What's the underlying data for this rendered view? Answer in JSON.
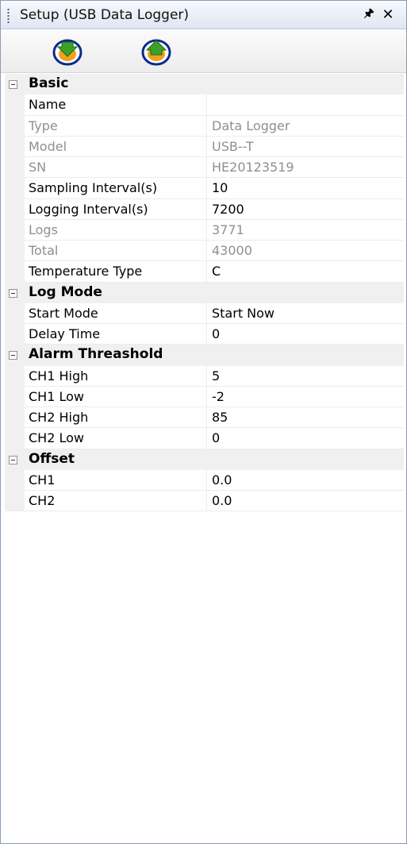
{
  "window": {
    "title": "Setup (USB Data Logger)",
    "pin_icon": "pin-icon",
    "close_icon": "close-icon"
  },
  "toolbar": {
    "download_icon": "download-arrow-icon",
    "upload_icon": "upload-arrow-icon",
    "colors": {
      "ring": "#0a2a8a",
      "fill": "#f0a020",
      "arrow": "#3ca12a"
    }
  },
  "categories": [
    {
      "label": "Basic",
      "props": [
        {
          "name": "Name",
          "value": "",
          "readonly": false
        },
        {
          "name": "Type",
          "value": "Data Logger",
          "readonly": true
        },
        {
          "name": "Model",
          "value": "USB--T",
          "readonly": true
        },
        {
          "name": "SN",
          "value": "HE20123519",
          "readonly": true
        },
        {
          "name": "Sampling Interval(s)",
          "value": "10",
          "readonly": false
        },
        {
          "name": "Logging Interval(s)",
          "value": "7200",
          "readonly": false
        },
        {
          "name": "Logs",
          "value": "3771",
          "readonly": true
        },
        {
          "name": "Total",
          "value": "43000",
          "readonly": true
        },
        {
          "name": "Temperature Type",
          "value": "C",
          "readonly": false
        }
      ]
    },
    {
      "label": "Log Mode",
      "props": [
        {
          "name": "Start Mode",
          "value": "Start Now",
          "readonly": false
        },
        {
          "name": "Delay Time",
          "value": "0",
          "readonly": false
        }
      ]
    },
    {
      "label": "Alarm Threashold",
      "props": [
        {
          "name": "CH1 High",
          "value": "5",
          "readonly": false
        },
        {
          "name": "CH1 Low",
          "value": "-2",
          "readonly": false
        },
        {
          "name": "CH2 High",
          "value": "85",
          "readonly": false
        },
        {
          "name": "CH2 Low",
          "value": "0",
          "readonly": false
        }
      ]
    },
    {
      "label": "Offset",
      "props": [
        {
          "name": "CH1",
          "value": "0.0",
          "readonly": false
        },
        {
          "name": "CH2",
          "value": "0.0",
          "readonly": false
        }
      ]
    }
  ]
}
